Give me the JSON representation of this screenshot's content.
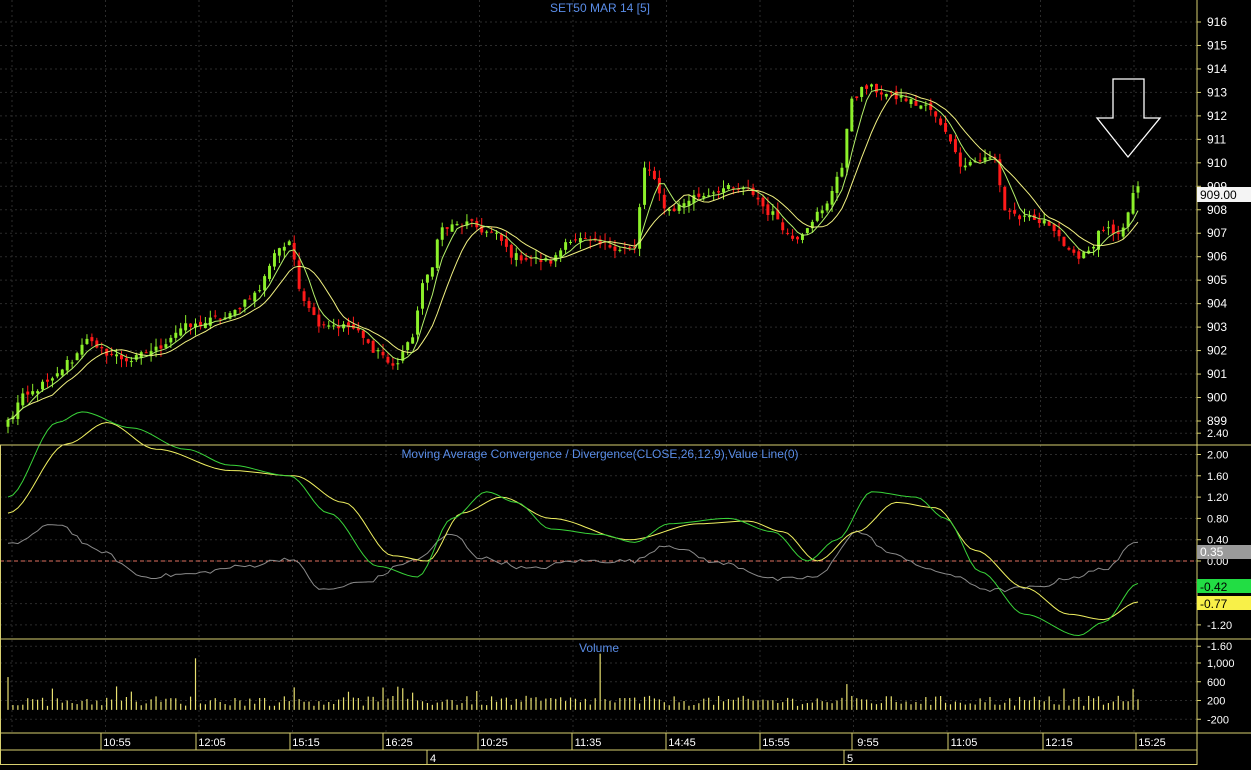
{
  "colors": {
    "background": "#000000",
    "grid": "#2b2b2b",
    "border": "#d8d070",
    "axis_text": "#ffffff",
    "title_text": "#5a8de8",
    "up_candle": "#8cf02a",
    "down_candle": "#ff1a1a",
    "ma_fast": "#b4f06a",
    "ma_slow": "#f0f080",
    "macd_line": "#39d339",
    "signal_line": "#f0f060",
    "histogram_line": "#8a8a8a",
    "zero_line": "#e07060",
    "volume_bar": "#e8e070"
  },
  "price_panel": {
    "title": "SET50 MAR 14   [5]",
    "y_ticks": [
      "916",
      "915",
      "914",
      "913",
      "912",
      "911",
      "910",
      "909",
      "908",
      "907",
      "906",
      "905",
      "904",
      "903",
      "902",
      "901",
      "900",
      "899"
    ],
    "last_price_label": "909.00"
  },
  "macd_panel": {
    "title": "Moving Average Convergence / Divergence(CLOSE,26,12,9),Value Line(0)",
    "y_ticks": [
      "2.40",
      "2.00",
      "1.60",
      "1.20",
      "0.80",
      "0.40",
      "0.00",
      "-0.40",
      "-0.80",
      "-1.20",
      "-1.60"
    ],
    "badges": [
      {
        "text": "0.35",
        "bg": "#9a9a9a",
        "fg": "#ffffff"
      },
      {
        "text": "-0.42",
        "bg": "#22dd44",
        "fg": "#000000"
      },
      {
        "text": "-0.77",
        "bg": "#f8f048",
        "fg": "#000000"
      }
    ]
  },
  "volume_panel": {
    "title": "Volume",
    "y_ticks": [
      "1,000",
      "600",
      "200",
      "-200"
    ]
  },
  "time_axis": {
    "labels": [
      "10:55",
      "12:05",
      "15:15",
      "16:25",
      "10:25",
      "11:35",
      "14:45",
      "15:55",
      "9:55",
      "11:05",
      "12:15",
      "15:25"
    ],
    "day_labels": [
      "4",
      "5"
    ]
  },
  "chart_data": [
    {
      "type": "candlestick",
      "title": "SET50 MAR 14   [5]",
      "ylim": [
        898.3,
        916.5
      ],
      "grid": true,
      "bar_count": 230,
      "x_tick_labels": [
        "10:55",
        "12:05",
        "15:15",
        "16:25",
        "10:25",
        "11:35",
        "14:45",
        "15:55",
        "9:55",
        "11:05",
        "12:15",
        "15:25"
      ],
      "close_anchors": [
        [
          0,
          899.0
        ],
        [
          3,
          900.0
        ],
        [
          8,
          900.6
        ],
        [
          13,
          901.6
        ],
        [
          16,
          902.6
        ],
        [
          18,
          902.0
        ],
        [
          25,
          901.6
        ],
        [
          29,
          902.0
        ],
        [
          36,
          903.0
        ],
        [
          44,
          903.4
        ],
        [
          50,
          904.4
        ],
        [
          55,
          906.4
        ],
        [
          57,
          906.5
        ],
        [
          60,
          904.2
        ],
        [
          63,
          903.2
        ],
        [
          69,
          903.0
        ],
        [
          75,
          902.0
        ],
        [
          78,
          901.3
        ],
        [
          81,
          902.2
        ],
        [
          85,
          905.2
        ],
        [
          88,
          907.2
        ],
        [
          93,
          907.4
        ],
        [
          98,
          907.0
        ],
        [
          103,
          906.0
        ],
        [
          110,
          905.8
        ],
        [
          114,
          906.8
        ],
        [
          120,
          906.5
        ],
        [
          127,
          906.3
        ],
        [
          129,
          909.8
        ],
        [
          134,
          908.0
        ],
        [
          140,
          908.6
        ],
        [
          145,
          908.9
        ],
        [
          150,
          908.8
        ],
        [
          155,
          907.8
        ],
        [
          159,
          906.8
        ],
        [
          165,
          907.9
        ],
        [
          169,
          909.8
        ],
        [
          171,
          912.8
        ],
        [
          174,
          913.2
        ],
        [
          180,
          912.8
        ],
        [
          186,
          912.4
        ],
        [
          190,
          911.4
        ],
        [
          193,
          910.0
        ],
        [
          200,
          910.2
        ],
        [
          202,
          908.0
        ],
        [
          206,
          907.6
        ],
        [
          211,
          907.4
        ],
        [
          216,
          906.0
        ],
        [
          219,
          906.3
        ],
        [
          222,
          907.2
        ],
        [
          225,
          906.8
        ],
        [
          229,
          909.0
        ]
      ],
      "moving_averages": [
        {
          "name": "MA fast"
        },
        {
          "name": "MA slow"
        }
      ],
      "last_close": 909.0
    },
    {
      "type": "line",
      "title": "Moving Average Convergence / Divergence(CLOSE,26,12,9),Value Line(0)",
      "ylim": [
        -1.95,
        2.6
      ],
      "value_line": 0,
      "series": [
        {
          "values_anchor": [
            [
              0,
              1.2
            ],
            [
              10,
              2.6
            ],
            [
              15,
              2.8
            ],
            [
              25,
              2.5
            ],
            [
              36,
              2.1
            ],
            [
              45,
              1.8
            ],
            [
              57,
              1.6
            ],
            [
              65,
              0.9
            ],
            [
              75,
              -0.1
            ],
            [
              83,
              -0.3
            ],
            [
              90,
              0.8
            ],
            [
              97,
              1.3
            ],
            [
              103,
              1.1
            ],
            [
              110,
              0.6
            ],
            [
              120,
              0.5
            ],
            [
              127,
              0.35
            ],
            [
              134,
              0.7
            ],
            [
              146,
              0.8
            ],
            [
              155,
              0.55
            ],
            [
              162,
              0.0
            ],
            [
              168,
              0.4
            ],
            [
              175,
              1.3
            ],
            [
              184,
              1.2
            ],
            [
              190,
              0.8
            ],
            [
              197,
              -0.2
            ],
            [
              206,
              -1.0
            ],
            [
              217,
              -1.4
            ],
            [
              222,
              -1.15
            ],
            [
              229,
              -0.42
            ]
          ]
        },
        {
          "values_anchor": [
            [
              0,
              0.9
            ],
            [
              12,
              2.2
            ],
            [
              20,
              2.6
            ],
            [
              30,
              2.1
            ],
            [
              45,
              1.7
            ],
            [
              58,
              1.6
            ],
            [
              68,
              1.1
            ],
            [
              78,
              0.1
            ],
            [
              85,
              0.0
            ],
            [
              92,
              0.9
            ],
            [
              100,
              1.2
            ],
            [
              110,
              0.8
            ],
            [
              126,
              0.4
            ],
            [
              140,
              0.7
            ],
            [
              150,
              0.75
            ],
            [
              157,
              0.55
            ],
            [
              164,
              0.0
            ],
            [
              172,
              0.55
            ],
            [
              180,
              1.1
            ],
            [
              188,
              1.0
            ],
            [
              196,
              0.2
            ],
            [
              206,
              -0.5
            ],
            [
              215,
              -1.0
            ],
            [
              222,
              -1.1
            ],
            [
              229,
              -0.77
            ]
          ]
        },
        {
          "values_anchor": [
            [
              0,
              0.3
            ],
            [
              10,
              0.7
            ],
            [
              18,
              0.2
            ],
            [
              28,
              -0.3
            ],
            [
              36,
              -0.25
            ],
            [
              48,
              -0.1
            ],
            [
              57,
              0.05
            ],
            [
              64,
              -0.55
            ],
            [
              72,
              -0.4
            ],
            [
              82,
              0.0
            ],
            [
              90,
              0.5
            ],
            [
              96,
              0.05
            ],
            [
              106,
              -0.15
            ],
            [
              115,
              0.0
            ],
            [
              127,
              0.0
            ],
            [
              133,
              0.3
            ],
            [
              145,
              -0.05
            ],
            [
              156,
              -0.35
            ],
            [
              164,
              -0.3
            ],
            [
              172,
              0.55
            ],
            [
              180,
              0.1
            ],
            [
              188,
              -0.2
            ],
            [
              200,
              -0.55
            ],
            [
              208,
              -0.5
            ],
            [
              216,
              -0.3
            ],
            [
              222,
              -0.15
            ],
            [
              229,
              0.35
            ]
          ]
        }
      ],
      "last_values": [
        0.35,
        -0.42,
        -0.77
      ]
    },
    {
      "type": "bar",
      "title": "Volume",
      "ylim": [
        -300,
        1200
      ],
      "spike_anchors": [
        [
          0,
          700
        ],
        [
          22,
          500
        ],
        [
          38,
          1100
        ],
        [
          120,
          1200
        ],
        [
          170,
          550
        ],
        [
          228,
          450
        ]
      ],
      "typical_volume": 240
    }
  ]
}
